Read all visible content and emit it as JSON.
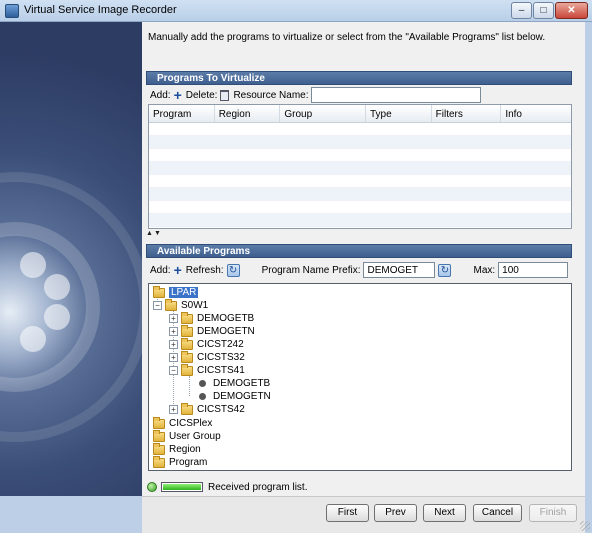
{
  "window": {
    "title": "Virtual Service Image Recorder",
    "minimize_glyph": "–",
    "maximize_glyph": "□",
    "close_glyph": "✕"
  },
  "instructions": "Manually add the programs to virtualize or select from the \"Available Programs\" list below.",
  "programs_to_virtualize": {
    "header": "Programs To Virtualize",
    "add_label": "Add:",
    "delete_label": "Delete:",
    "resource_name_label": "Resource Name:",
    "resource_name_value": "",
    "columns": [
      "Program",
      "Region",
      "Group",
      "Type",
      "Filters",
      "Info"
    ],
    "rows": []
  },
  "available_programs": {
    "header": "Available Programs",
    "add_label": "Add:",
    "refresh_label": "Refresh:",
    "prefix_label": "Program Name Prefix:",
    "prefix_value": "DEMOGET",
    "max_label": "Max:",
    "max_value": "100",
    "tree": {
      "lpar": "LPAR",
      "s0w1": "S0W1",
      "demogetb": "DEMOGETB",
      "demogetn": "DEMOGETN",
      "cicst242": "CICST242",
      "cicsts32": "CICSTS32",
      "cicsts41": "CICSTS41",
      "leaf_demogetb": "DEMOGETB",
      "leaf_demogetn": "DEMOGETN",
      "cicsts42": "CICSTS42",
      "cicsplex": "CICSPlex",
      "user_group": "User Group",
      "region": "Region",
      "program": "Program"
    }
  },
  "status": {
    "text": "Received program list.",
    "progress_fraction": 1.0,
    "color": "#39a02a"
  },
  "buttons": {
    "first": "First",
    "prev": "Prev",
    "next": "Next",
    "cancel": "Cancel",
    "finish": "Finish"
  },
  "colors": {
    "section_header": "#4a6a98",
    "selection": "#3a73c8"
  }
}
